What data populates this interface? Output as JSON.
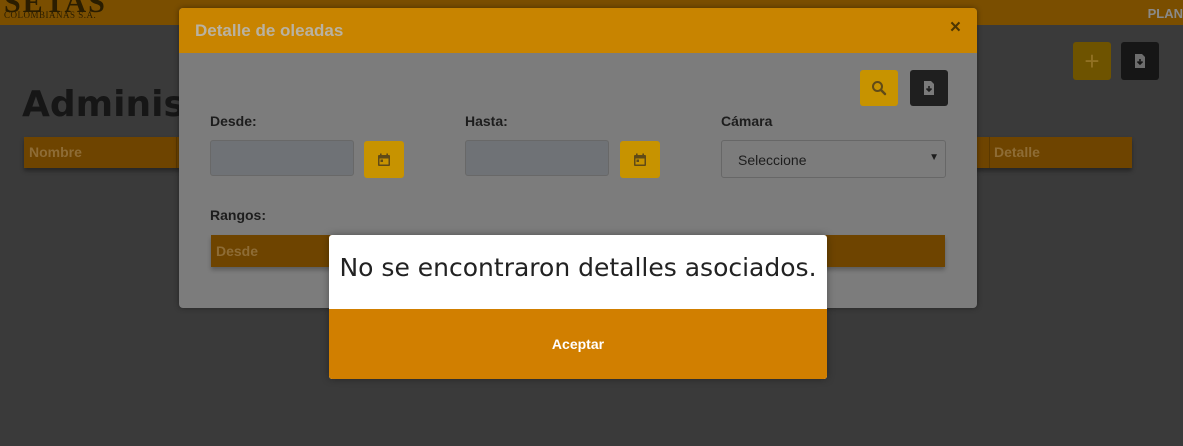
{
  "app": {
    "logo_main": "SETAS",
    "logo_sub": "COLOMBIANAS S.A.",
    "top_right_link": "PLAN"
  },
  "page": {
    "title": "Administr",
    "add_icon": "plus-icon",
    "download_icon": "download-icon",
    "table_headers": [
      "Nombre",
      "Detalle"
    ]
  },
  "modal": {
    "title": "Detalle de oleadas",
    "close_glyph": "×",
    "search_icon": "search-icon",
    "export_icon": "file-download-icon",
    "desde_label": "Desde:",
    "desde_value": "",
    "hasta_label": "Hasta:",
    "hasta_value": "",
    "camara_label": "Cámara",
    "camara_selected": "Seleccione",
    "calendar_icon": "calendar-icon",
    "rangos_label": "Rangos:",
    "rangos_headers": [
      "Desde"
    ]
  },
  "alert": {
    "message": "No se encontraron detalles asociados.",
    "button_label": "Aceptar"
  },
  "colors": {
    "accent": "#d17f00",
    "header_orange": "#c88400",
    "button_gold": "#c79300",
    "dark_button": "#1f1f1f",
    "overlay_bg": "#3a3a3a"
  }
}
